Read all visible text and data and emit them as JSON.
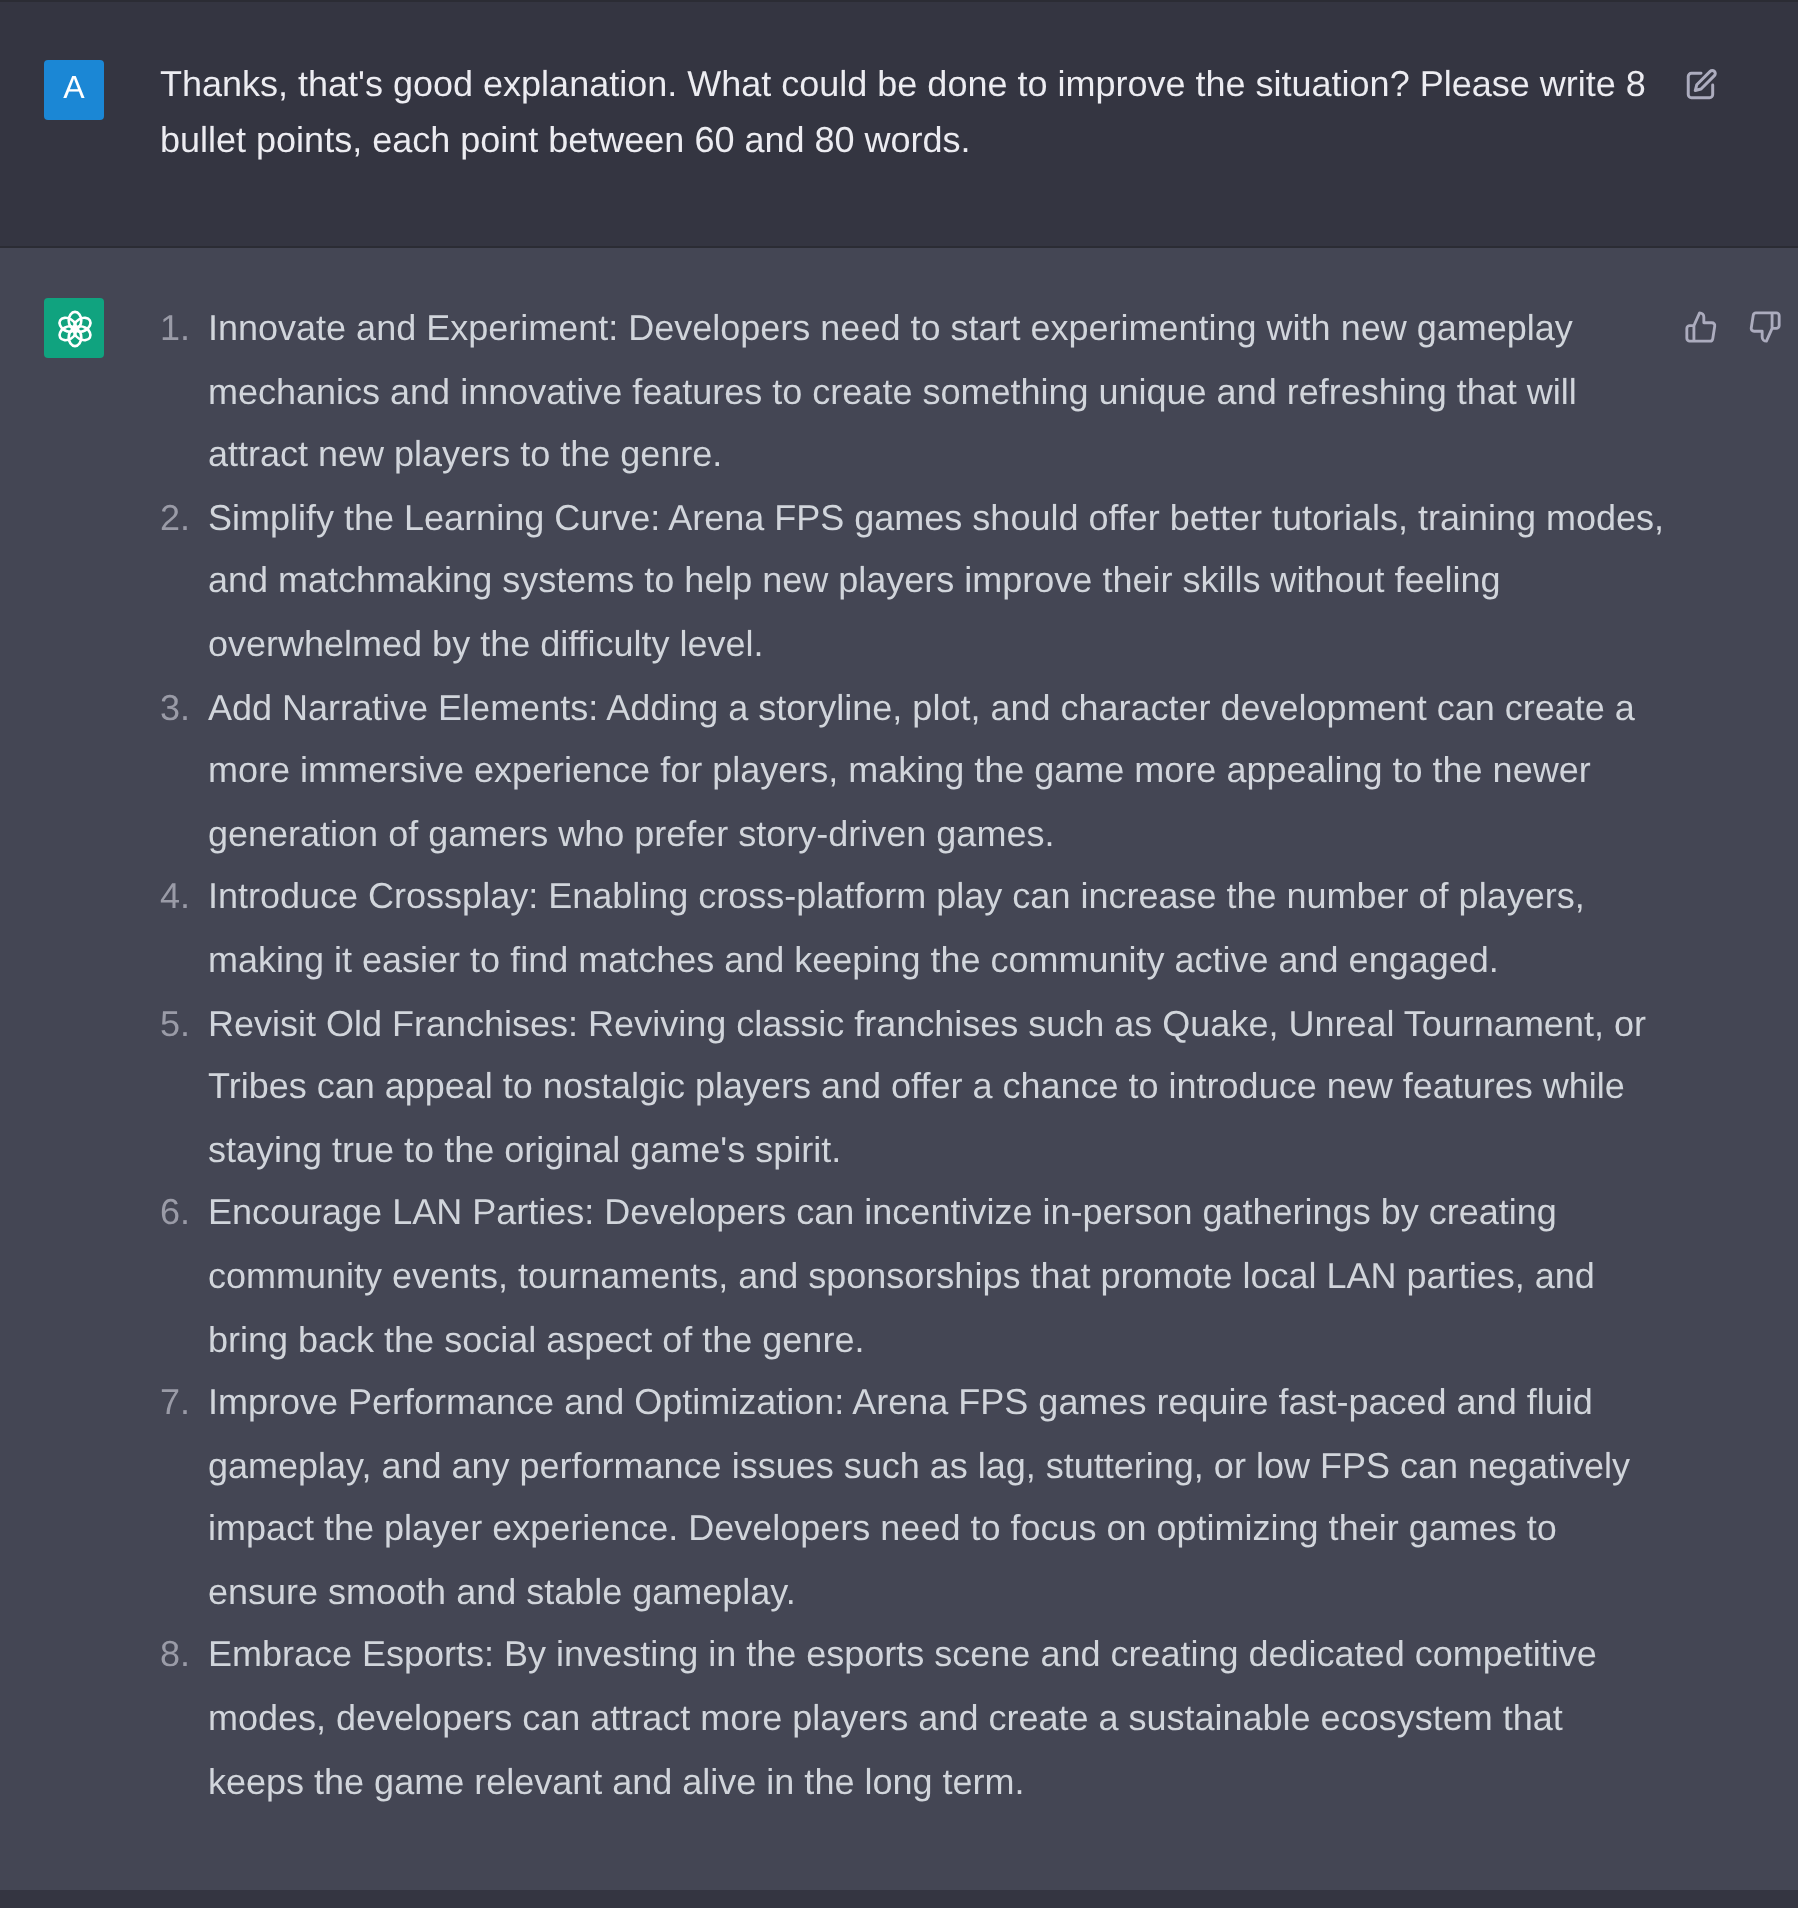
{
  "user_message": {
    "avatar_letter": "A",
    "text": "Thanks, that's good explanation. What could be done to improve the situation? Please write 8 bullet points, each point between 60 and 80 words."
  },
  "assistant_message": {
    "items": [
      {
        "number": "1.",
        "text": "Innovate and Experiment: Developers need to start experimenting with new gameplay mechanics and innovative features to create something unique and refreshing that will attract new players to the genre."
      },
      {
        "number": "2.",
        "text": "Simplify the Learning Curve: Arena FPS games should offer better tutorials, training modes, and matchmaking systems to help new players improve their skills without feeling overwhelmed by the difficulty level."
      },
      {
        "number": "3.",
        "text": "Add Narrative Elements: Adding a storyline, plot, and character development can create a more immersive experience for players, making the game more appealing to the newer generation of gamers who prefer story-driven games."
      },
      {
        "number": "4.",
        "text": "Introduce Crossplay: Enabling cross-platform play can increase the number of players, making it easier to find matches and keeping the community active and engaged."
      },
      {
        "number": "5.",
        "text": "Revisit Old Franchises: Reviving classic franchises such as Quake, Unreal Tournament, or Tribes can appeal to nostalgic players and offer a chance to introduce new features while staying true to the original game's spirit."
      },
      {
        "number": "6.",
        "text": "Encourage LAN Parties: Developers can incentivize in-person gatherings by creating community events, tournaments, and sponsorships that promote local LAN parties, and bring back the social aspect of the genre."
      },
      {
        "number": "7.",
        "text": "Improve Performance and Optimization: Arena FPS games require fast-paced and fluid gameplay, and any performance issues such as lag, stuttering, or low FPS can negatively impact the player experience. Developers need to focus on optimizing their games to ensure smooth and stable gameplay."
      },
      {
        "number": "8.",
        "text": "Embrace Esports: By investing in the esports scene and creating dedicated competitive modes, developers can attract more players and create a sustainable ecosystem that keeps the game relevant and alive in the long term."
      }
    ]
  }
}
